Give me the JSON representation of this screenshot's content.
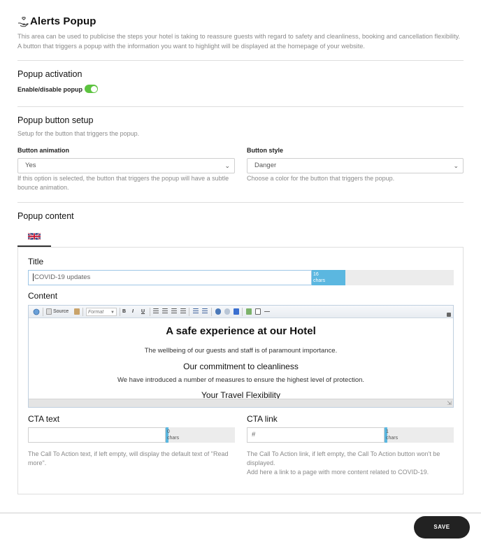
{
  "header": {
    "title": "Alerts Popup",
    "description_line1": "This area can be used to publicise the steps your hotel is taking to reassure guests with regard to safety and cleanliness, booking and cancellation flexibility.",
    "description_line2": "A button that triggers a popup with the information you want to highlight will be displayed at the homepage of your website."
  },
  "activation": {
    "section_title": "Popup activation",
    "toggle_label": "Enable/disable popup",
    "enabled": true
  },
  "button_setup": {
    "section_title": "Popup button setup",
    "subtitle": "Setup for the button that triggers the popup.",
    "animation_label": "Button animation",
    "animation_value": "Yes",
    "animation_help_line1": "If this option is selected, the button that triggers the popup will have a subtle",
    "animation_help_line2": "bounce animation.",
    "style_label": "Button style",
    "style_value": "Danger",
    "style_help": "Choose a color for the button that triggers the popup."
  },
  "content": {
    "section_title": "Popup content",
    "title_label": "Title",
    "title_value": "COVID-19 updates",
    "title_count": "16",
    "chars_label": "chars",
    "content_label": "Content",
    "toolbar": {
      "source": "Source",
      "format": "Format",
      "bold": "B",
      "italic": "I",
      "underline": "U"
    },
    "editor": {
      "heading": "A safe experience at our Hotel",
      "para1": "The wellbeing of our guests and staff is of paramount importance.",
      "heading2": "Our commitment to cleanliness",
      "para2": "We have introduced a number of measures to ensure the highest level of protection.",
      "heading3": "Your Travel Flexibility"
    },
    "cta_text_label": "CTA text",
    "cta_text_value": "",
    "cta_text_count": "0",
    "cta_text_help_line1": "The Call To Action text, if left empty, will display the default text of \"Read",
    "cta_text_help_line2": "more\".",
    "cta_link_label": "CTA link",
    "cta_link_value": "#",
    "cta_link_count": "1",
    "cta_link_help_line1": "The Call To Action link, if left empty, the Call To Action button won't be",
    "cta_link_help_line2": "displayed.",
    "cta_link_help_line3": "Add here a link to a page with more content related to COVID-19."
  },
  "footer": {
    "save_label": "SAVE"
  },
  "colors": {
    "toggle_on": "#5cc33f",
    "counter_blue": "#5bb7e0",
    "save_bg": "#222222"
  }
}
